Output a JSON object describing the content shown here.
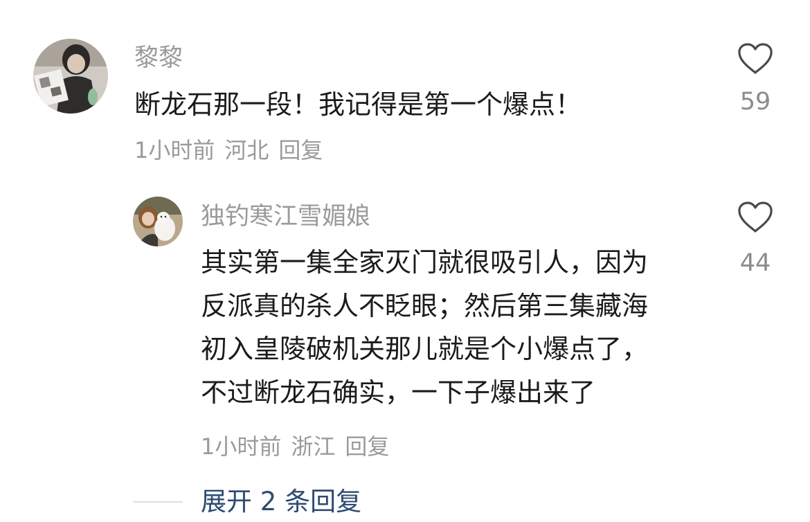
{
  "comments": [
    {
      "username": "黎黎",
      "content": "断龙石那一段！我记得是第一个爆点！",
      "time": "1小时前",
      "location": "河北",
      "reply_label": "回复",
      "likes": "59",
      "avatar_icon": "user-avatar-photo-holding-comic"
    },
    {
      "username": "独钓寒江雪媚娘",
      "content_lines": [
        "其实第一集全家灭门就很吸引人，因为",
        "反派真的杀人不眨眼；然后第三集藏海",
        "初入皇陵破机关那儿就是个小爆点了，",
        "不过断龙石确实，一下子爆出来了"
      ],
      "time": "1小时前",
      "location": "浙江",
      "reply_label": "回复",
      "likes": "44",
      "avatar_icon": "user-avatar-photo-holding-plush"
    }
  ],
  "expand_replies": {
    "label": "展开 2 条回复"
  },
  "colors": {
    "username": "#9a9a9a",
    "content": "#1b1b1b",
    "meta": "#9a9a9a",
    "like_count": "#8c8c8c",
    "expand_link": "#2e4a72",
    "heart_stroke": "#4a4a4a"
  },
  "icons": {
    "like": "heart-outline-icon"
  }
}
